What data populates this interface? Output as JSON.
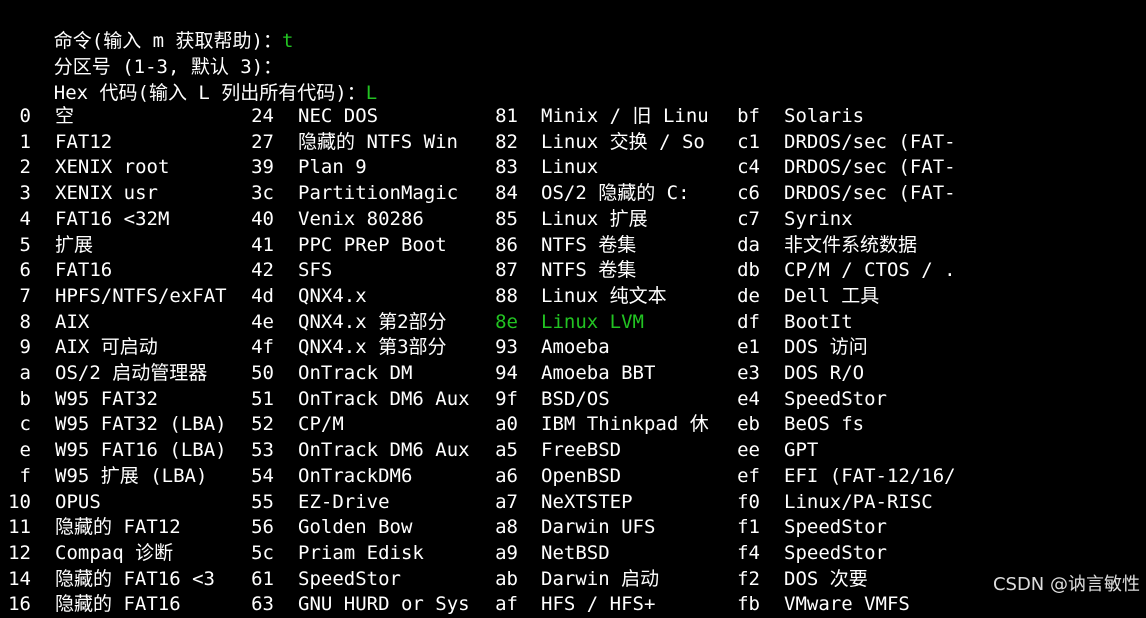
{
  "prompts": [
    {
      "label": "命令(输入 m 获取帮助)：",
      "input": "t"
    },
    {
      "label": "分区号 (1-3, 默认 3)：",
      "input": ""
    },
    {
      "label": "Hex 代码(输入 L 列出所有代码)：",
      "input": "L"
    }
  ],
  "partition_types": [
    [
      {
        "code": "0",
        "name": "空"
      },
      {
        "code": "24",
        "name": "NEC DOS"
      },
      {
        "code": "81",
        "name": "Minix / 旧 Linu"
      },
      {
        "code": "bf",
        "name": "Solaris"
      }
    ],
    [
      {
        "code": "1",
        "name": "FAT12"
      },
      {
        "code": "27",
        "name": "隐藏的 NTFS Win"
      },
      {
        "code": "82",
        "name": "Linux 交换 / So"
      },
      {
        "code": "c1",
        "name": "DRDOS/sec (FAT-"
      }
    ],
    [
      {
        "code": "2",
        "name": "XENIX root"
      },
      {
        "code": "39",
        "name": "Plan 9"
      },
      {
        "code": "83",
        "name": "Linux"
      },
      {
        "code": "c4",
        "name": "DRDOS/sec (FAT-"
      }
    ],
    [
      {
        "code": "3",
        "name": "XENIX usr"
      },
      {
        "code": "3c",
        "name": "PartitionMagic"
      },
      {
        "code": "84",
        "name": "OS/2 隐藏的 C:"
      },
      {
        "code": "c6",
        "name": "DRDOS/sec (FAT-"
      }
    ],
    [
      {
        "code": "4",
        "name": "FAT16 <32M"
      },
      {
        "code": "40",
        "name": "Venix 80286"
      },
      {
        "code": "85",
        "name": "Linux 扩展"
      },
      {
        "code": "c7",
        "name": "Syrinx"
      }
    ],
    [
      {
        "code": "5",
        "name": "扩展"
      },
      {
        "code": "41",
        "name": "PPC PReP Boot"
      },
      {
        "code": "86",
        "name": "NTFS 卷集"
      },
      {
        "code": "da",
        "name": "非文件系统数据"
      }
    ],
    [
      {
        "code": "6",
        "name": "FAT16"
      },
      {
        "code": "42",
        "name": "SFS"
      },
      {
        "code": "87",
        "name": "NTFS 卷集"
      },
      {
        "code": "db",
        "name": "CP/M / CTOS / ."
      }
    ],
    [
      {
        "code": "7",
        "name": "HPFS/NTFS/exFAT"
      },
      {
        "code": "4d",
        "name": "QNX4.x"
      },
      {
        "code": "88",
        "name": "Linux 纯文本"
      },
      {
        "code": "de",
        "name": "Dell 工具"
      }
    ],
    [
      {
        "code": "8",
        "name": "AIX"
      },
      {
        "code": "4e",
        "name": "QNX4.x 第2部分"
      },
      {
        "code": "8e",
        "name": "Linux LVM",
        "highlight": true
      },
      {
        "code": "df",
        "name": "BootIt"
      }
    ],
    [
      {
        "code": "9",
        "name": "AIX 可启动"
      },
      {
        "code": "4f",
        "name": "QNX4.x 第3部分"
      },
      {
        "code": "93",
        "name": "Amoeba"
      },
      {
        "code": "e1",
        "name": "DOS 访问"
      }
    ],
    [
      {
        "code": "a",
        "name": "OS/2 启动管理器"
      },
      {
        "code": "50",
        "name": "OnTrack DM"
      },
      {
        "code": "94",
        "name": "Amoeba BBT"
      },
      {
        "code": "e3",
        "name": "DOS R/O"
      }
    ],
    [
      {
        "code": "b",
        "name": "W95 FAT32"
      },
      {
        "code": "51",
        "name": "OnTrack DM6 Aux"
      },
      {
        "code": "9f",
        "name": "BSD/OS"
      },
      {
        "code": "e4",
        "name": "SpeedStor"
      }
    ],
    [
      {
        "code": "c",
        "name": "W95 FAT32 (LBA)"
      },
      {
        "code": "52",
        "name": "CP/M"
      },
      {
        "code": "a0",
        "name": "IBM Thinkpad 休"
      },
      {
        "code": "eb",
        "name": "BeOS fs"
      }
    ],
    [
      {
        "code": "e",
        "name": "W95 FAT16 (LBA)"
      },
      {
        "code": "53",
        "name": "OnTrack DM6 Aux"
      },
      {
        "code": "a5",
        "name": "FreeBSD"
      },
      {
        "code": "ee",
        "name": "GPT"
      }
    ],
    [
      {
        "code": "f",
        "name": "W95 扩展 (LBA)"
      },
      {
        "code": "54",
        "name": "OnTrackDM6"
      },
      {
        "code": "a6",
        "name": "OpenBSD"
      },
      {
        "code": "ef",
        "name": "EFI (FAT-12/16/"
      }
    ],
    [
      {
        "code": "10",
        "name": "OPUS"
      },
      {
        "code": "55",
        "name": "EZ-Drive"
      },
      {
        "code": "a7",
        "name": "NeXTSTEP"
      },
      {
        "code": "f0",
        "name": "Linux/PA-RISC"
      }
    ],
    [
      {
        "code": "11",
        "name": "隐藏的 FAT12"
      },
      {
        "code": "56",
        "name": "Golden Bow"
      },
      {
        "code": "a8",
        "name": "Darwin UFS"
      },
      {
        "code": "f1",
        "name": "SpeedStor"
      }
    ],
    [
      {
        "code": "12",
        "name": "Compaq 诊断"
      },
      {
        "code": "5c",
        "name": "Priam Edisk"
      },
      {
        "code": "a9",
        "name": "NetBSD"
      },
      {
        "code": "f4",
        "name": "SpeedStor"
      }
    ],
    [
      {
        "code": "14",
        "name": "隐藏的 FAT16 <3"
      },
      {
        "code": "61",
        "name": "SpeedStor"
      },
      {
        "code": "ab",
        "name": "Darwin 启动"
      },
      {
        "code": "f2",
        "name": "DOS 次要"
      }
    ],
    [
      {
        "code": "16",
        "name": "隐藏的 FAT16"
      },
      {
        "code": "63",
        "name": "GNU HURD or Sys"
      },
      {
        "code": "af",
        "name": "HFS / HFS+"
      },
      {
        "code": "fb",
        "name": "VMware VMFS"
      }
    ]
  ],
  "watermark": "CSDN @讷言敏性",
  "colors": {
    "background": "#000000",
    "text": "#ffffff",
    "input_highlight": "#22c322"
  }
}
